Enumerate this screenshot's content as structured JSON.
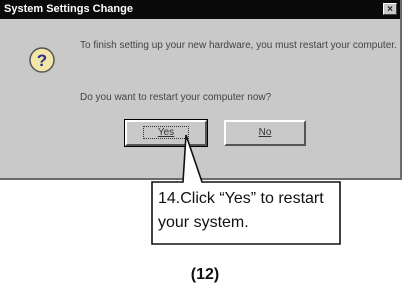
{
  "dialog": {
    "title": "System Settings Change",
    "close_glyph": "×",
    "icon": "question-icon",
    "message_line1": "To finish setting up your new hardware, you must restart your computer.",
    "message_line2": "Do you want to restart your computer now?",
    "yes_label": "Yes",
    "no_label": "No"
  },
  "callout": {
    "text": "14.Click “Yes” to restart your system."
  },
  "page": {
    "number": "(12)"
  }
}
